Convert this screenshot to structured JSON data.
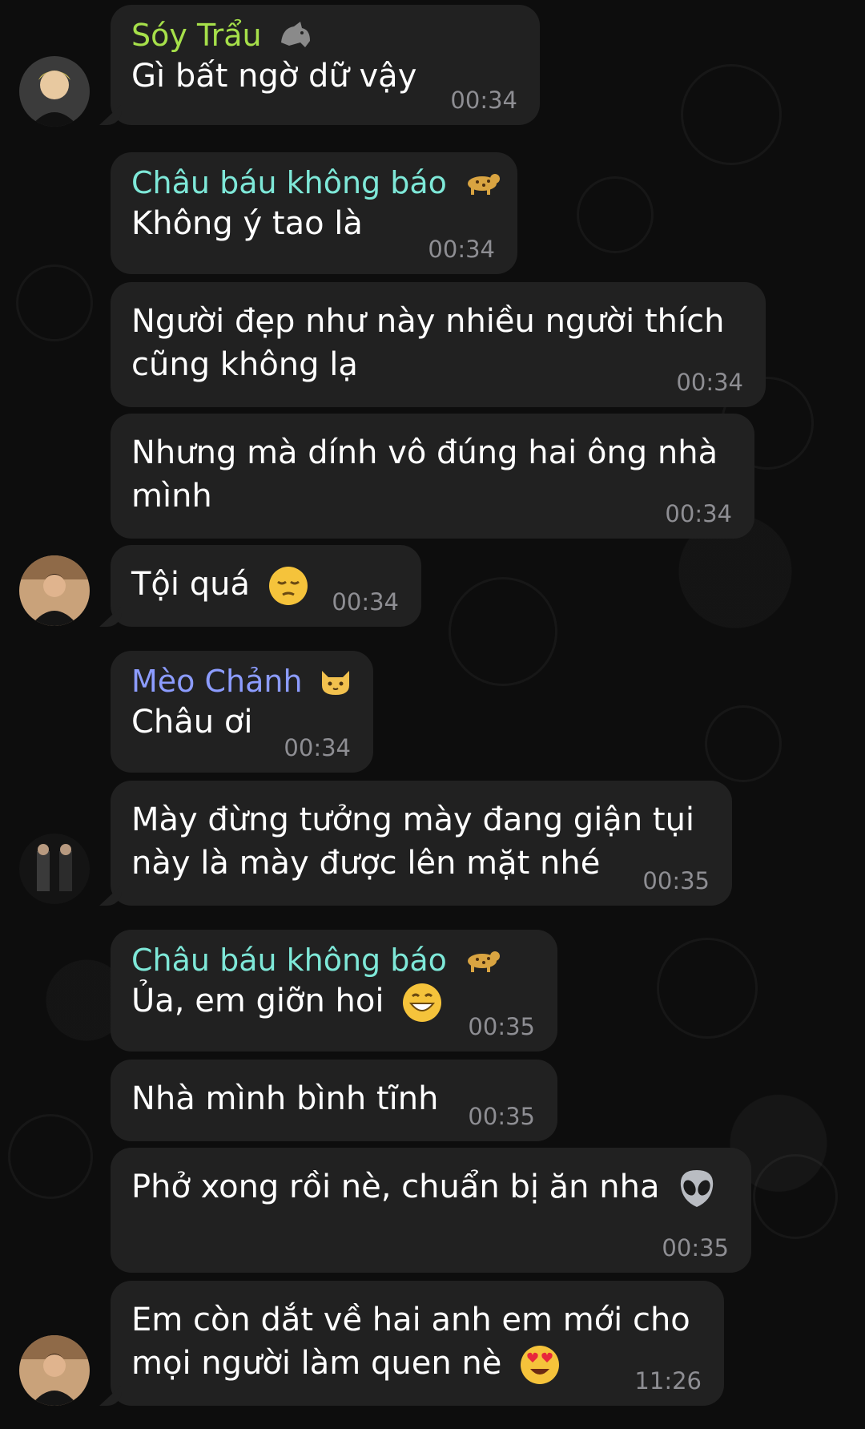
{
  "messages": [
    {
      "sender": "Sóy Trẩu",
      "sender_color": "#a6e04a",
      "sender_emoji": "rhino",
      "text": "Gì bất ngờ dữ vậy",
      "time": "00:34"
    },
    {
      "sender": "Châu báu không báo",
      "sender_color": "#7ee8d8",
      "sender_emoji": "leopard",
      "text": "Không ý tao là",
      "time": "00:34"
    },
    {
      "text_lines": [
        "Người đẹp như này nhiều người thích",
        "cũng không lạ"
      ],
      "time": "00:34"
    },
    {
      "text_lines": [
        "Nhưng mà dính vô đúng hai ông nhà",
        "mình"
      ],
      "time": "00:34"
    },
    {
      "text": "Tội quá",
      "emoji": "pensive-face",
      "time": "00:34"
    },
    {
      "sender": "Mèo Chảnh",
      "sender_color": "#8c9cff",
      "sender_emoji": "cat-face",
      "text": "Châu ơi",
      "time": "00:34"
    },
    {
      "text_lines": [
        "Mày đừng tưởng mày đang giận tụi",
        "này là mày được lên mặt nhé"
      ],
      "time": "00:35"
    },
    {
      "sender": "Châu báu không báo",
      "sender_color": "#7ee8d8",
      "sender_emoji": "leopard",
      "text": "Ủa, em giỡn hoi",
      "emoji": "grinning-face",
      "time": "00:35"
    },
    {
      "text": "Nhà mình bình tĩnh",
      "time": "00:35"
    },
    {
      "text": "Phở xong rồi nè, chuẩn bị ăn nha",
      "emoji": "alien",
      "time": "00:35"
    },
    {
      "text_lines": [
        "Em còn dắt về hai anh em mới cho",
        "mọi người làm quen nè"
      ],
      "emoji": "heart-eyes-face",
      "time": "11:26"
    }
  ]
}
